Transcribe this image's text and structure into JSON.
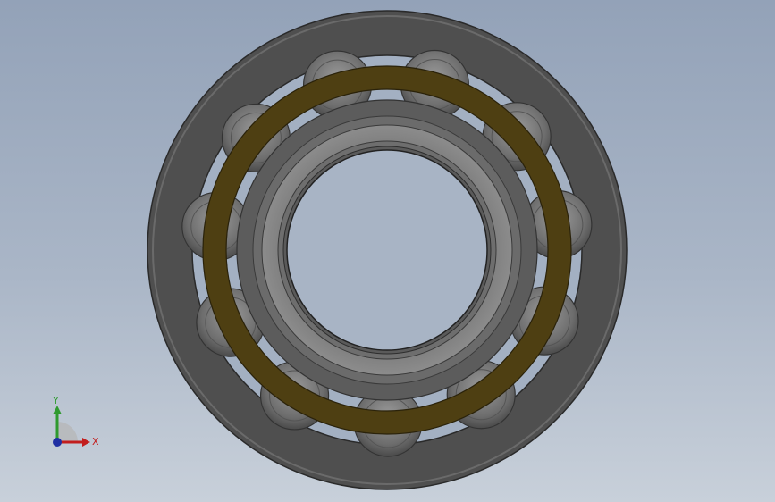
{
  "viewport": {
    "background_top": "#93a2b8",
    "background_bottom": "#c8d0da"
  },
  "model": {
    "outer_ring_color": "#5a5a5a",
    "cage_color": "#4e3f12",
    "roller_color": "#7a7a7a",
    "inner_ring_color": "#7d7d7d",
    "roller_count": 11
  },
  "triad": {
    "x_label": "X",
    "y_label": "Y",
    "x_color": "#c21e1e",
    "y_color": "#2f9a2f",
    "z_color": "#1f2fa3"
  }
}
